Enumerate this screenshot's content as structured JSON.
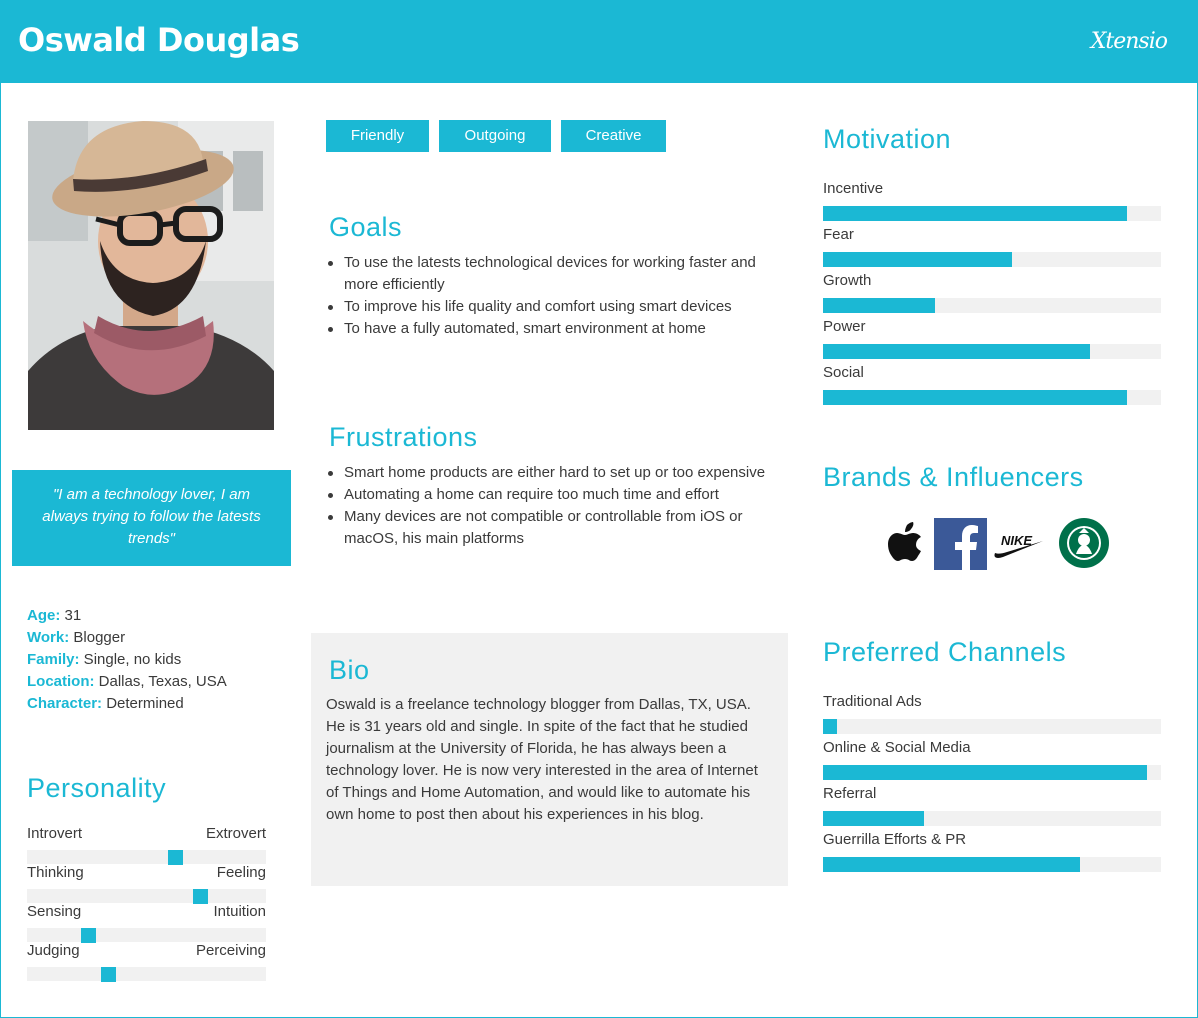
{
  "header": {
    "name": "Oswald Douglas",
    "logo": "Xtensio"
  },
  "quote": "\"I am a technology lover,  I am always trying to follow the latests trends\"",
  "info": [
    {
      "key": "Age:",
      "value": " 31"
    },
    {
      "key": "Work:",
      "value": " Blogger"
    },
    {
      "key": "Family:",
      "value": " Single, no kids"
    },
    {
      "key": "Location:",
      "value": " Dallas, Texas, USA"
    },
    {
      "key": "Character:",
      "value": " Determined"
    }
  ],
  "personality": {
    "title": "Personality",
    "traits": [
      {
        "left": "Introvert",
        "right": "Extrovert",
        "level": 0.63
      },
      {
        "left": "Thinking",
        "right": "Feeling",
        "level": 0.74
      },
      {
        "left": "Sensing",
        "right": "Intuition",
        "level": 0.24
      },
      {
        "left": "Judging",
        "right": "Perceiving",
        "level": 0.33
      }
    ]
  },
  "tags": [
    "Friendly",
    "Outgoing",
    "Creative"
  ],
  "goals": {
    "title": "Goals",
    "items": [
      "To use the latests technological devices for working faster and more efficiently",
      "To improve his life quality and comfort using smart devices",
      "To have a fully automated, smart environment at home"
    ]
  },
  "frustrations": {
    "title": "Frustrations",
    "items": [
      "Smart home products are either hard to set up or too expensive",
      "Automating a home can require too much time and effort",
      "Many devices are not compatible or controllable from iOS or macOS, his main platforms"
    ]
  },
  "bio": {
    "title": "Bio",
    "text": "Oswald is a freelance technology blogger from Dallas, TX, USA. He is 31 years old and single. In spite of the fact that he studied journalism at the University of Florida, he has always been a technology lover. He is now very interested in the area of Internet of Things and Home Automation, and would like to automate his own home to post then about his experiences in his blog."
  },
  "motivation": {
    "title": "Motivation",
    "items": [
      {
        "label": "Incentive",
        "level": 0.9
      },
      {
        "label": "Fear",
        "level": 0.56
      },
      {
        "label": "Growth",
        "level": 0.33
      },
      {
        "label": "Power",
        "level": 0.79
      },
      {
        "label": "Social",
        "level": 0.9
      }
    ]
  },
  "brands": {
    "title": "Brands & Influencers",
    "icons": [
      "apple-logo",
      "facebook-logo",
      "nike-logo",
      "starbucks-logo"
    ],
    "nike_text": "NIKE"
  },
  "channels": {
    "title": "Preferred Channels",
    "items": [
      {
        "label": "Traditional Ads",
        "level": 0.04
      },
      {
        "label": "Online & Social Media",
        "level": 0.96
      },
      {
        "label": "Referral",
        "level": 0.3
      },
      {
        "label": "Guerrilla Efforts & PR",
        "level": 0.76
      }
    ]
  },
  "colors": {
    "accent": "#1bb8d4",
    "track": "#f1f1f1",
    "text": "#3a3a3a"
  }
}
